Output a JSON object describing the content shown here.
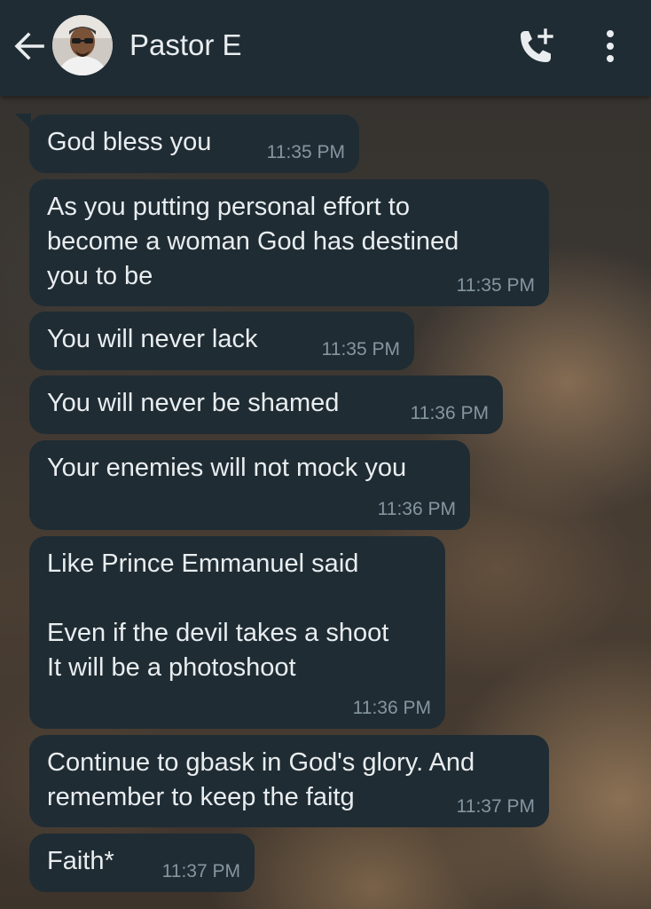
{
  "header": {
    "contact_name": "Pastor E",
    "back_icon": "arrow-left-icon",
    "call_icon": "add-call-icon",
    "menu_icon": "more-vertical-icon"
  },
  "colors": {
    "bar": "#1f2c34",
    "bubble": "#1f2c34",
    "text": "#e9edef",
    "timestamp": "#8696a0"
  },
  "messages": [
    {
      "text": "God bless you",
      "time": "11:35 PM"
    },
    {
      "text": "As you putting personal effort to\nbecome a woman God has destined\nyou to be",
      "time": "11:35 PM"
    },
    {
      "text": "You will never lack",
      "time": "11:35 PM"
    },
    {
      "text": "You will never be shamed",
      "time": "11:36 PM"
    },
    {
      "text": "Your enemies will not mock you",
      "time": "11:36 PM"
    },
    {
      "text": "Like Prince Emmanuel said\n\nEven if the devil takes a shoot\nIt will be a photoshoot",
      "time": "11:36 PM"
    },
    {
      "text": "Continue to gbask in God's glory. And\nremember to keep the faitg",
      "time": "11:37 PM"
    },
    {
      "text": "Faith*",
      "time": "11:37 PM"
    }
  ]
}
